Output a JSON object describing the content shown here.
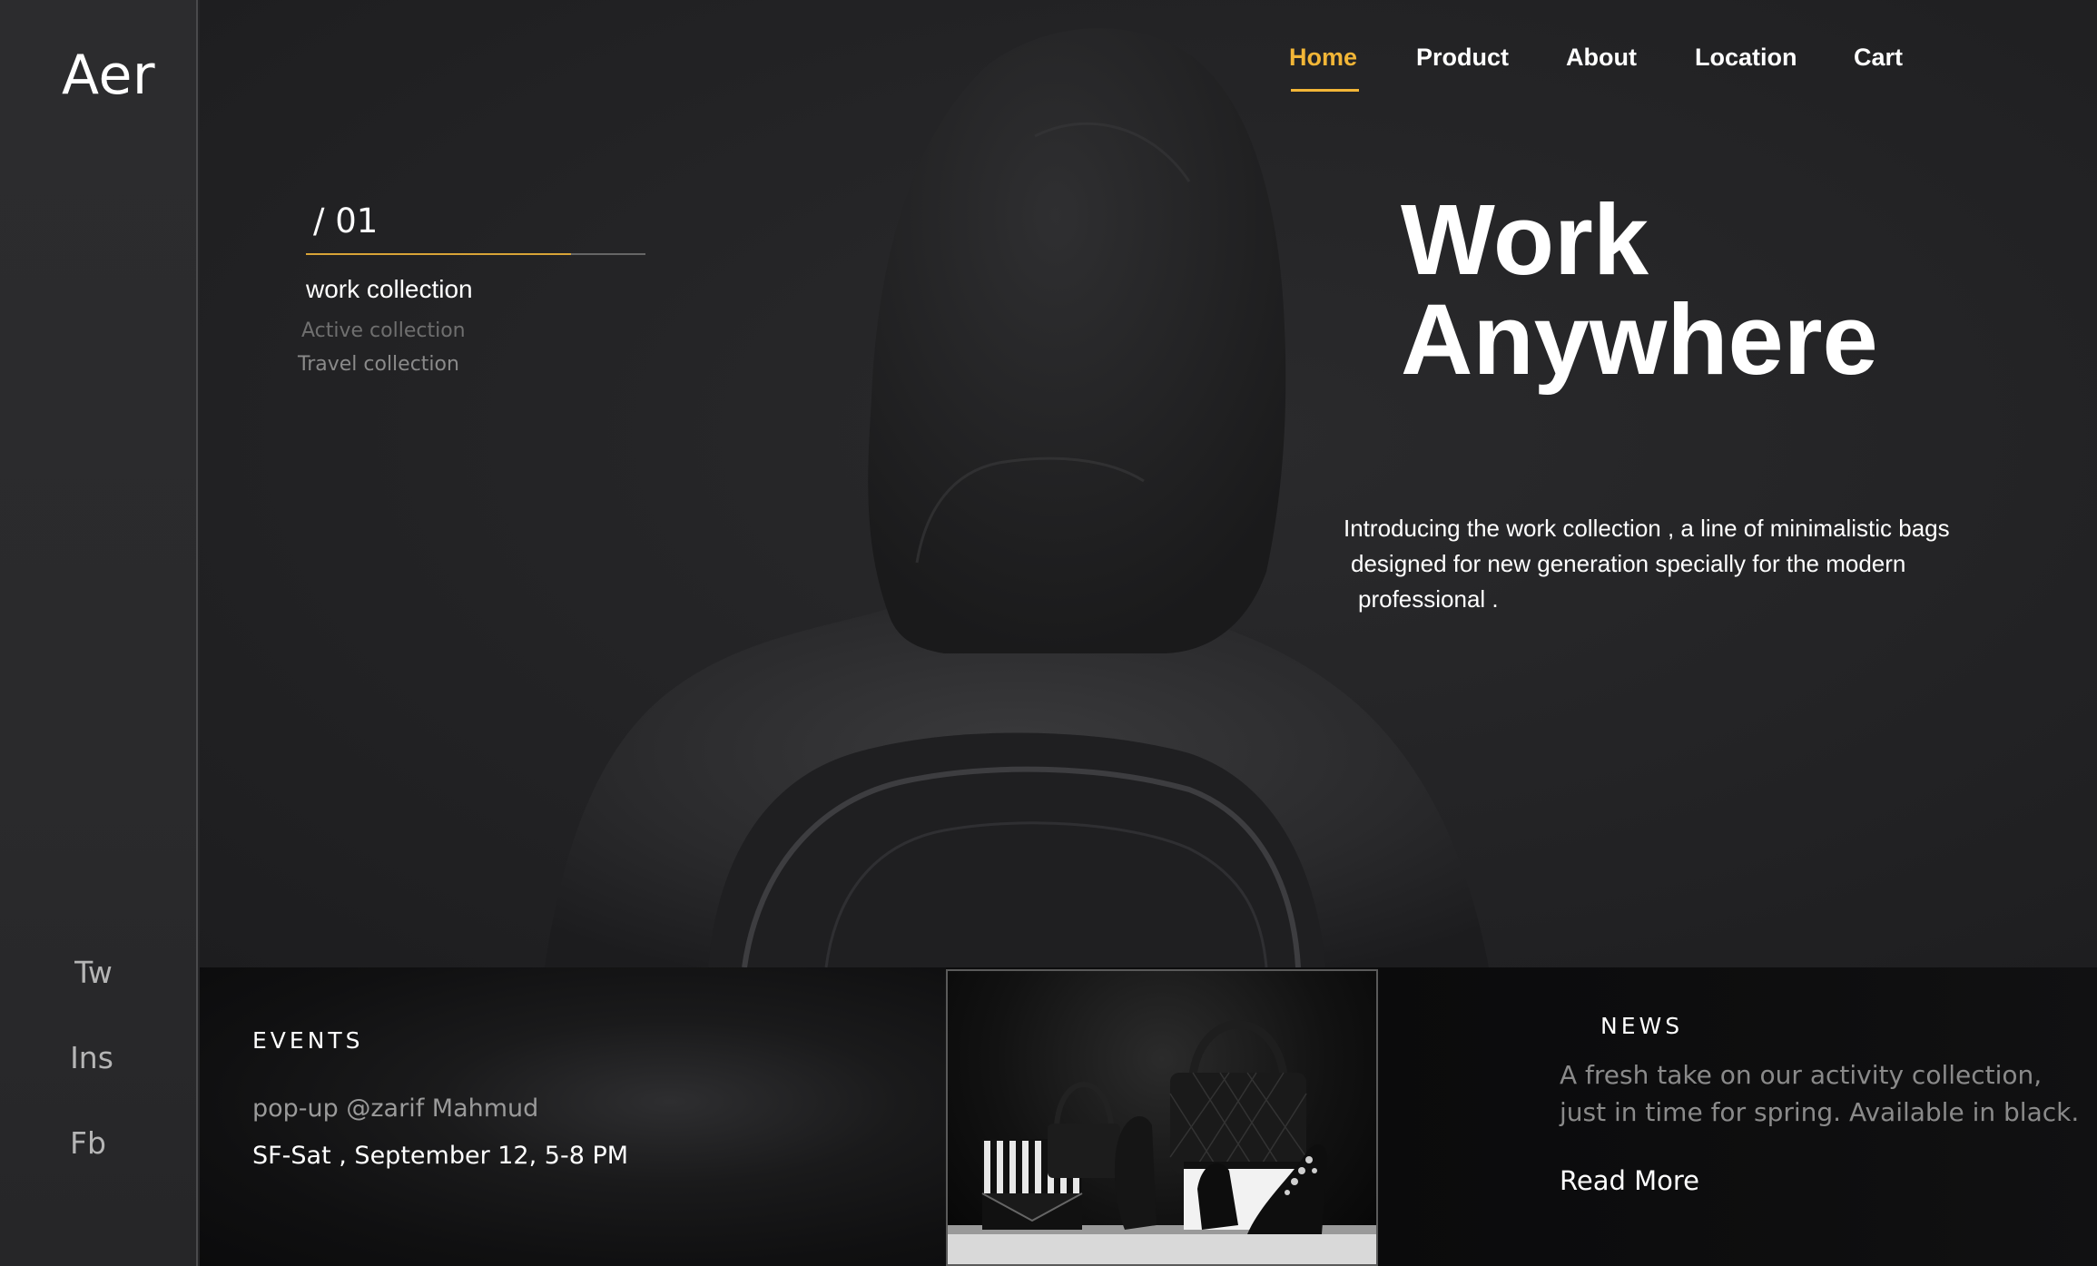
{
  "brand": {
    "logo": "Aer"
  },
  "social": {
    "twitter": "Tw",
    "instagram": "Ins",
    "facebook": "Fb"
  },
  "nav": {
    "items": [
      {
        "label": "Home",
        "active": true
      },
      {
        "label": "Product",
        "active": false
      },
      {
        "label": "About",
        "active": false
      },
      {
        "label": "Location",
        "active": false
      },
      {
        "label": "Cart",
        "active": false
      }
    ]
  },
  "collections": {
    "index": "/ 01",
    "progress": 0.78,
    "active": "work collection",
    "items": [
      "Active collection",
      "Travel collection"
    ]
  },
  "hero": {
    "headline_line1": "Work",
    "headline_line2": "Anywhere",
    "intro_line1": "Introducing the work collection , a line of minimalistic bags",
    "intro_line2": "designed for new generation specially for the modern",
    "intro_line3": "professional ."
  },
  "events": {
    "title": "EVENTS",
    "host": "pop-up @zarif Mahmud",
    "date": "SF-Sat , September 12, 5-8 PM"
  },
  "news": {
    "title": "NEWS",
    "text_line1": "A fresh take on our activity  collection,",
    "text_line2": "just in time for spring. Available  in black.",
    "read_more": "Read More"
  },
  "colors": {
    "accent": "#f2b637",
    "background": "#232325",
    "sidebar": "#2b2b2d"
  }
}
